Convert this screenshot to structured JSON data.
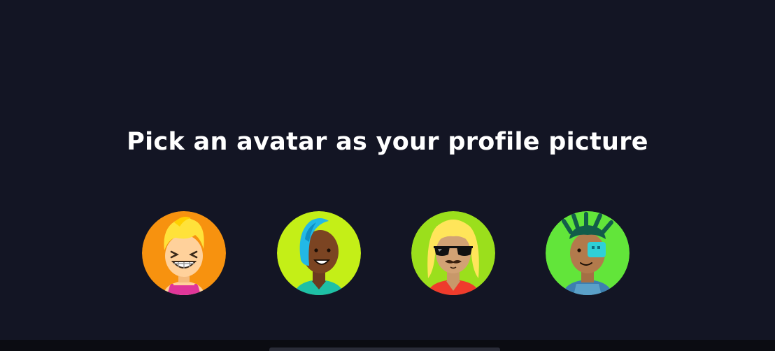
{
  "prompt": {
    "title": "Pick an avatar as your profile picture"
  },
  "avatars": [
    {
      "icon": "blonde-grinning-avatar-icon",
      "background": "#f7920f"
    },
    {
      "icon": "teal-hair-smiling-avatar-icon",
      "background": "#c4ef17"
    },
    {
      "icon": "sunglasses-mustache-avatar-icon",
      "background": "#9bdf1c"
    },
    {
      "icon": "dreadlocks-eyepatch-avatar-icon",
      "background": "#62e53a"
    }
  ],
  "colors": {
    "background": "#131524",
    "text": "#ffffff"
  }
}
